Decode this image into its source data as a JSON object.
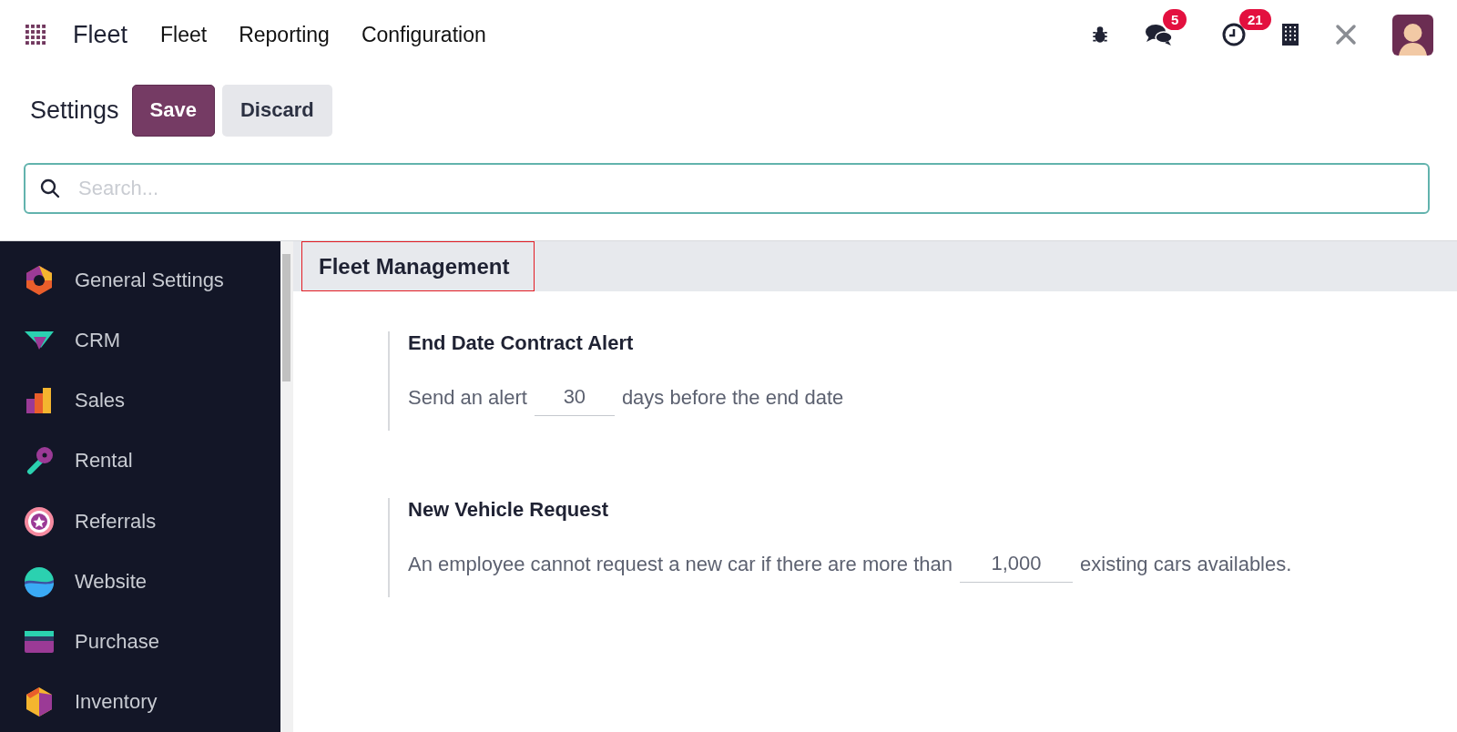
{
  "navbar": {
    "app_name": "Fleet",
    "menu": [
      "Fleet",
      "Reporting",
      "Configuration"
    ],
    "messages_badge": "5",
    "activities_badge": "21"
  },
  "control_panel": {
    "title": "Settings",
    "buttons": [
      "Save",
      "Discard"
    ]
  },
  "search": {
    "placeholder": "Search..."
  },
  "sidebar": {
    "items": [
      {
        "label": "General Settings",
        "selected": false
      },
      {
        "label": "CRM",
        "selected": false
      },
      {
        "label": "Sales",
        "selected": false
      },
      {
        "label": "Rental",
        "selected": false
      },
      {
        "label": "Referrals",
        "selected": false
      },
      {
        "label": "Website",
        "selected": false
      },
      {
        "label": "Purchase",
        "selected": false
      },
      {
        "label": "Inventory",
        "selected": false
      }
    ]
  },
  "section": {
    "title": "Fleet Management",
    "highlighted": true,
    "settings": [
      {
        "title": "End Date Contract Alert",
        "before": "Send an alert",
        "value": "30",
        "after": "days before the end date"
      },
      {
        "title": "New Vehicle Request",
        "before": "An employee cannot request a new car if there are more than",
        "value": "1,000",
        "after": "existing cars availables."
      }
    ]
  }
}
